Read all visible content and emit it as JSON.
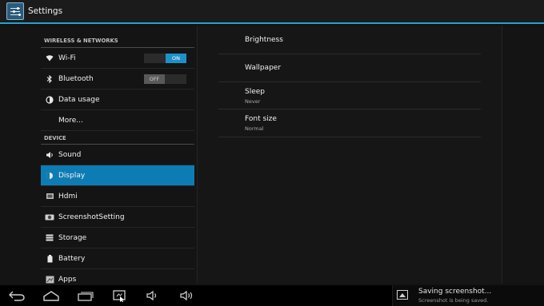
{
  "action_bar": {
    "title": "Settings",
    "icon": "settings-sliders-icon"
  },
  "left": {
    "sections": [
      {
        "header": "WIRELESS & NETWORKS",
        "items": [
          {
            "label": "Wi-Fi",
            "icon": "wifi-icon",
            "toggle": "ON"
          },
          {
            "label": "Bluetooth",
            "icon": "bluetooth-icon",
            "toggle": "OFF"
          },
          {
            "label": "Data usage",
            "icon": "data-usage-icon"
          },
          {
            "label": "More..."
          }
        ]
      },
      {
        "header": "DEVICE",
        "items": [
          {
            "label": "Sound",
            "icon": "speaker-icon"
          },
          {
            "label": "Display",
            "icon": "display-icon",
            "selected": true
          },
          {
            "label": "Hdmi",
            "icon": "hdmi-icon"
          },
          {
            "label": "ScreenshotSetting",
            "icon": "camera-icon"
          },
          {
            "label": "Storage",
            "icon": "storage-icon"
          },
          {
            "label": "Battery",
            "icon": "battery-icon"
          },
          {
            "label": "Apps",
            "icon": "apps-icon"
          }
        ]
      }
    ]
  },
  "right": {
    "items": [
      {
        "title": "Brightness"
      },
      {
        "title": "Wallpaper"
      },
      {
        "title": "Sleep",
        "summary": "Never"
      },
      {
        "title": "Font size",
        "summary": "Normal"
      }
    ]
  },
  "navbar": {
    "buttons": [
      "back-icon",
      "home-icon",
      "recent-apps-icon",
      "screenshot-icon",
      "volume-down-icon",
      "volume-up-icon"
    ],
    "notification": {
      "title": "Saving screenshot...",
      "subtitle": "Screenshot is being saved.",
      "icon": "image-icon"
    }
  },
  "colors": {
    "accent": "#2b9fd0",
    "selected": "#0e7cb4",
    "background": "#141414"
  }
}
